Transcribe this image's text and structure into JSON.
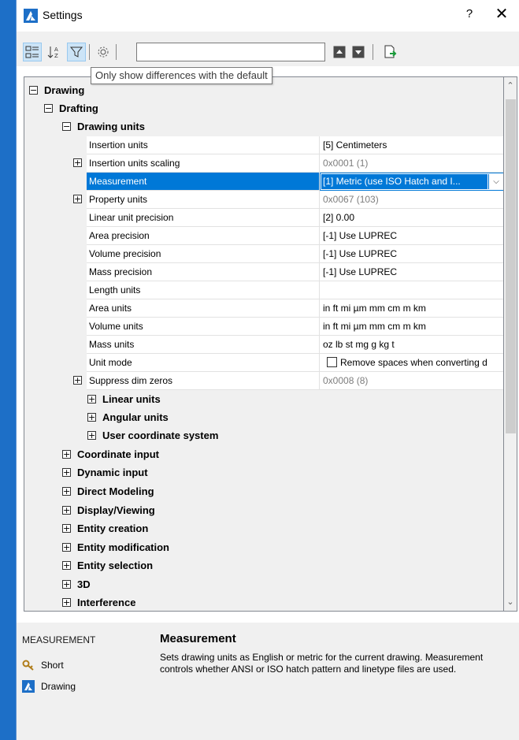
{
  "window": {
    "title": "Settings",
    "help_label": "?",
    "close_label": "✕"
  },
  "toolbar": {
    "search_value": "",
    "tooltip": "Only show differences with the default"
  },
  "tree": {
    "root": "Drawing",
    "drafting": "Drafting",
    "drawing_units": "Drawing units",
    "properties": [
      {
        "name": "Insertion units",
        "value": "[5] Centimeters"
      },
      {
        "name": "Insertion units scaling",
        "value": "0x0001 (1)"
      },
      {
        "name": "Measurement",
        "value": "[1] Metric (use ISO Hatch and I..."
      },
      {
        "name": "Property units",
        "value": "0x0067 (103)"
      },
      {
        "name": "Linear unit precision",
        "value": "[2] 0.00"
      },
      {
        "name": "Area precision",
        "value": "[-1] Use LUPREC"
      },
      {
        "name": "Volume precision",
        "value": "[-1] Use LUPREC"
      },
      {
        "name": "Mass precision",
        "value": "[-1] Use LUPREC"
      },
      {
        "name": "Length units",
        "value": ""
      },
      {
        "name": "Area units",
        "value": "in ft mi µm mm cm m km"
      },
      {
        "name": "Volume units",
        "value": "in ft mi µm mm cm m km"
      },
      {
        "name": "Mass units",
        "value": "oz lb st mg g kg t"
      },
      {
        "name": "Unit mode",
        "value": "Remove spaces when converting d"
      },
      {
        "name": "Suppress dim zeros",
        "value": "0x0008 (8)"
      }
    ],
    "drafting_subcats": [
      "Linear units",
      "Angular units",
      "User coordinate system"
    ],
    "categories": [
      "Coordinate input",
      "Dynamic input",
      "Direct Modeling",
      "Display/Viewing",
      "Entity creation",
      "Entity modification",
      "Entity selection",
      "3D",
      "Interference"
    ]
  },
  "details": {
    "category": "MEASUREMENT",
    "title": "Measurement",
    "description": "Sets drawing units as English or metric for the current drawing. Measurement controls whether ANSI or ISO hatch pattern and linetype files are used.",
    "short_label": "Short",
    "drawing_label": "Drawing"
  },
  "colors": {
    "selection": "#0078d7",
    "accent_bar": "#1d6fc7"
  }
}
